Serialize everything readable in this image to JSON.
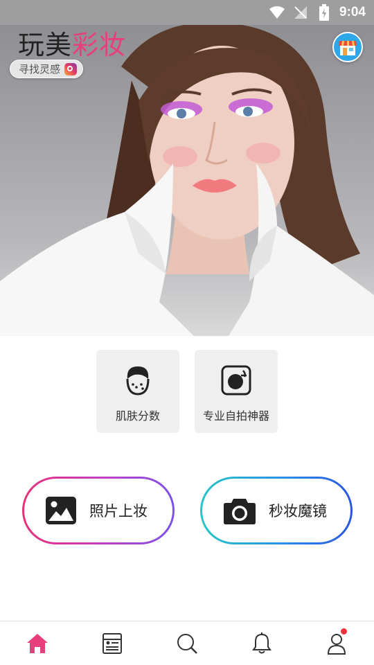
{
  "status_bar": {
    "time": "9:04"
  },
  "hero": {
    "brand_part1": "玩美",
    "brand_part2": "彩妆",
    "inspiration_label": "寻找灵感"
  },
  "features": [
    {
      "label": "肌肤分数",
      "icon": "face-skin-icon"
    },
    {
      "label": "专业自拍神器",
      "icon": "selfie-camera-icon"
    }
  ],
  "actions": [
    {
      "label": "照片上妆",
      "icon": "image-icon"
    },
    {
      "label": "秒妆魔镜",
      "icon": "camera-icon"
    }
  ],
  "bottom_nav": {
    "items": [
      "home-icon",
      "news-icon",
      "search-icon",
      "bell-icon",
      "user-icon"
    ],
    "active": "home-icon",
    "accent": "#e83e7c",
    "notification_badge_color": "#f0313b"
  },
  "colors": {
    "brand_pink": "#e83e7c",
    "status_bar": "#9e9e9e"
  }
}
